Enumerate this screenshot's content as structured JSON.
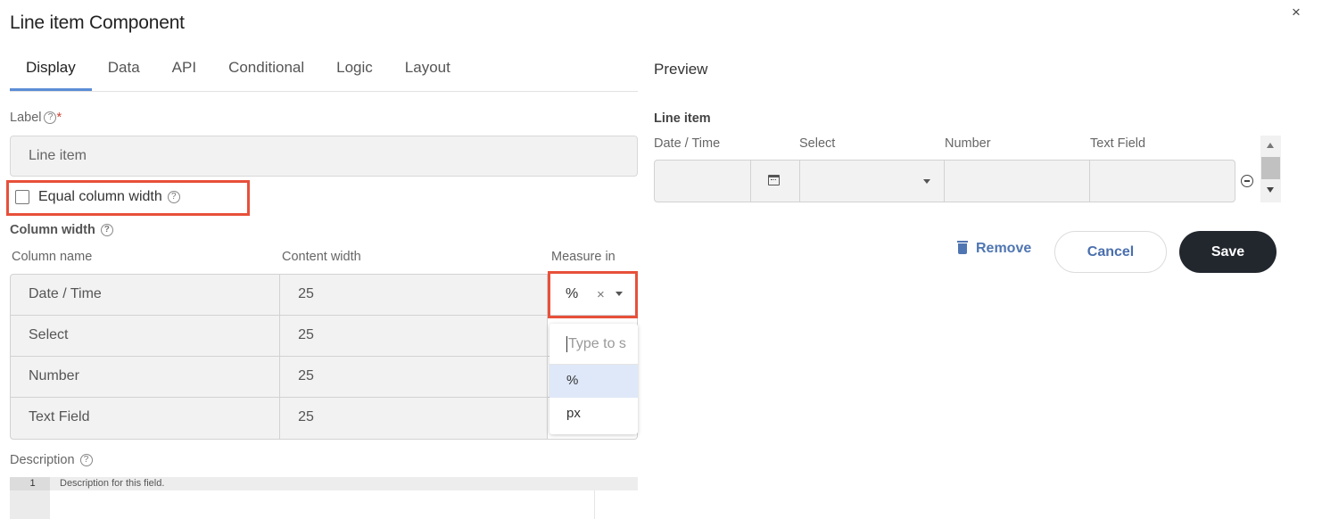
{
  "dialog": {
    "title": "Line item Component"
  },
  "tabs": [
    {
      "label": "Display",
      "active": true
    },
    {
      "label": "Data"
    },
    {
      "label": "API"
    },
    {
      "label": "Conditional"
    },
    {
      "label": "Logic"
    },
    {
      "label": "Layout"
    }
  ],
  "form": {
    "label_field": {
      "label": "Label",
      "required_mark": "*",
      "value": "Line item"
    },
    "equal_width": {
      "label": "Equal column width",
      "checked": false
    },
    "column_width": {
      "label": "Column width",
      "headers": {
        "name": "Column name",
        "width": "Content width",
        "measure": "Measure in"
      },
      "rows": [
        {
          "name": "Date / Time",
          "width": "25"
        },
        {
          "name": "Select",
          "width": "25"
        },
        {
          "name": "Number",
          "width": "25"
        },
        {
          "name": "Text Field",
          "width": "25"
        }
      ],
      "measure_selected": "%",
      "clear_glyph": "×"
    },
    "measure_dropdown": {
      "placeholder": "Type to s",
      "options": [
        "%",
        "px"
      ],
      "selected": "%"
    },
    "description": {
      "label": "Description",
      "line_number": "1",
      "text": "Description for this field."
    }
  },
  "preview": {
    "title": "Preview",
    "component_label": "Line item",
    "columns": [
      "Date / Time",
      "Select",
      "Number",
      "Text Field"
    ]
  },
  "actions": {
    "remove": "Remove",
    "cancel": "Cancel",
    "save": "Save"
  },
  "help_glyph": "?",
  "close_glyph": "×",
  "colors": {
    "highlight": "#e8503a",
    "accent": "#5b8dd6",
    "link": "#4f76b2",
    "save_bg": "#22272e"
  }
}
